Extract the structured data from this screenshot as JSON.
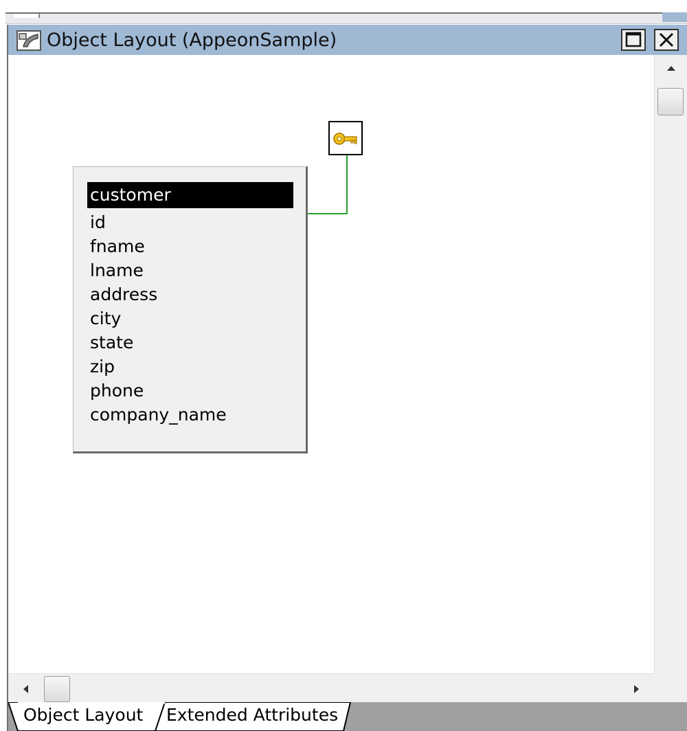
{
  "window": {
    "title": "Object Layout (AppeonSample)"
  },
  "table": {
    "name": "customer",
    "columns": [
      "id",
      "fname",
      "lname",
      "address",
      "city",
      "state",
      "zip",
      "phone",
      "company_name"
    ]
  },
  "tabs": [
    "Object Layout",
    "Extended Attributes"
  ],
  "icons": {
    "window": "layout-icon",
    "key": "key-icon",
    "maximize": "maximize-icon",
    "close": "close-icon"
  },
  "colors": {
    "titlebar": "#9fb8d4",
    "header_bg": "#000000",
    "connector": "#2aa02a",
    "key": "#e8b010"
  }
}
